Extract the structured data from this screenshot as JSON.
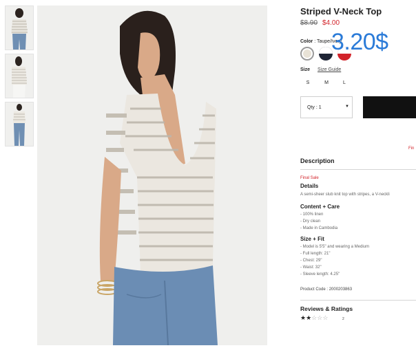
{
  "product": {
    "title": "Striped V-Neck Top",
    "old_price": "$8.90",
    "new_price": "$4.00",
    "overlay_price": "3.20$"
  },
  "color": {
    "label": "Color",
    "value": ": Taupe/Ivory",
    "swatches": [
      {
        "name": "taupe-ivory",
        "color": "#e8e2d6",
        "selected": true
      },
      {
        "name": "navy-white",
        "color": "#1e2435",
        "selected": false
      },
      {
        "name": "red-white",
        "color": "#d2232a",
        "selected": false
      }
    ]
  },
  "size": {
    "label": "Size",
    "guide": "Size Guide",
    "options": [
      "S",
      "M",
      "L"
    ]
  },
  "quantity": {
    "label": "Qty : 1",
    "arrow": "▼"
  },
  "fine_print": "Fin",
  "description": {
    "heading": "Description",
    "final_sale": "Final Sale",
    "details_heading": "Details",
    "details_text": "A semi-sheer slub knit top with stripes, a V-neckli",
    "content_heading": "Content + Care",
    "content_items": [
      "- 100% linen",
      "- Dry clean",
      "- Made in Cambodia"
    ],
    "fit_heading": "Size + Fit",
    "fit_items": [
      "- Model is 5'5\" and wearing a Medium",
      "- Full length: 21\"",
      "- Chest: 29\"",
      "- Waist: 32\"",
      "- Sleeve length: 4.25\""
    ],
    "product_code": "Product Code : 2000203863"
  },
  "reviews": {
    "heading": "Reviews & Ratings",
    "rating": 2,
    "max": 5,
    "count": "2",
    "star_full": "★",
    "star_empty": "☆"
  },
  "colors": {
    "sale_red": "#d21f26",
    "overlay_blue": "#2b7bd8",
    "button_black": "#111111"
  }
}
